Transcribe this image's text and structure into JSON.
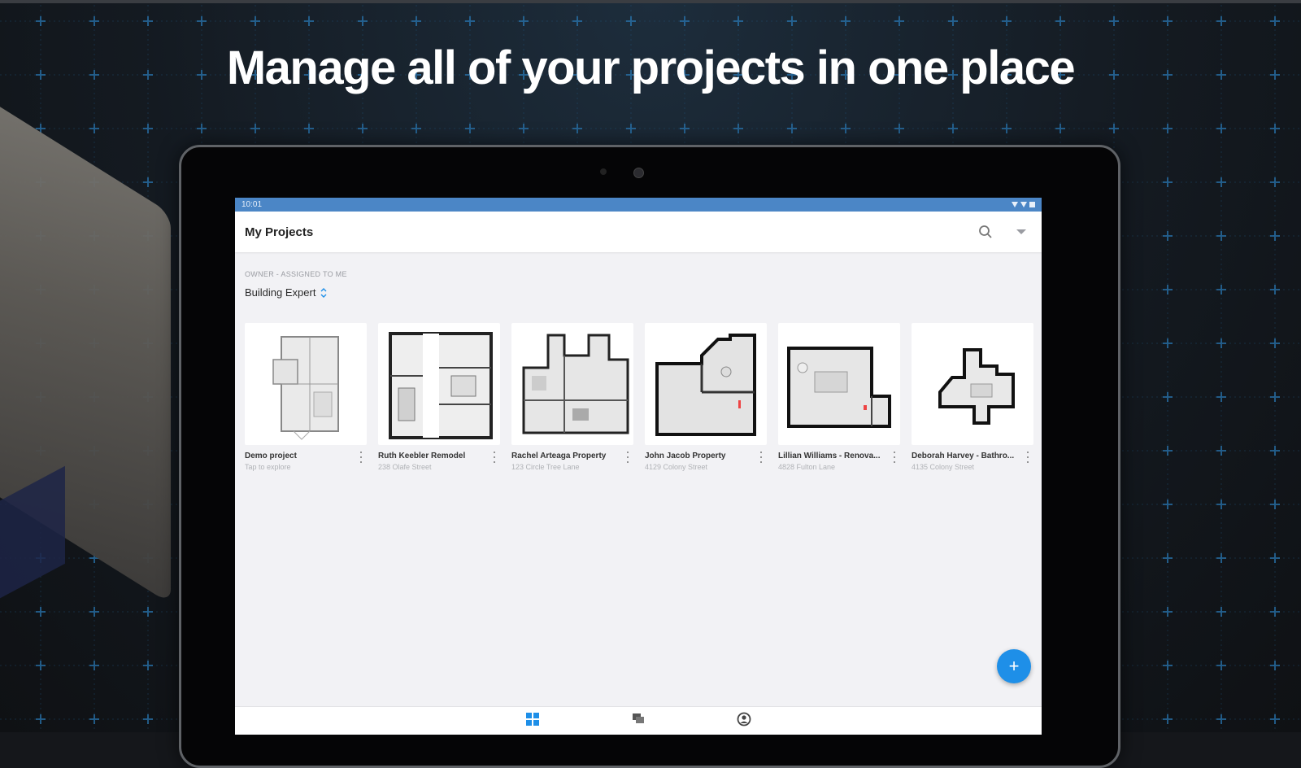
{
  "headline": "Manage all of your projects in one place",
  "colors": {
    "status_bar": "#4b86c6",
    "fab": "#1e8fe8",
    "nav_active": "#1e8fe8",
    "grid_lines": "#1f5d8a"
  },
  "status_bar": {
    "time": "10:01",
    "icons": [
      "wifi-icon",
      "signal-icon",
      "battery-icon"
    ]
  },
  "app_bar": {
    "title": "My Projects",
    "actions": [
      "search-icon",
      "filter-icon"
    ]
  },
  "filter": {
    "label": "OWNER - ASSIGNED TO ME",
    "workspace": "Building Expert"
  },
  "projects": [
    {
      "title": "Demo project",
      "subtitle": "Tap to explore"
    },
    {
      "title": "Ruth Keebler Remodel",
      "subtitle": "238 Olafe Street"
    },
    {
      "title": "Rachel Arteaga Property",
      "subtitle": "123 Circle Tree Lane"
    },
    {
      "title": "John Jacob Property",
      "subtitle": "4129 Colony Street"
    },
    {
      "title": "Lillian Williams - Renova...",
      "subtitle": "4828 Fulton Lane"
    },
    {
      "title": "Deborah Harvey - Bathro...",
      "subtitle": "4135 Colony Street"
    }
  ],
  "fab": {
    "label": "+"
  },
  "bottom_nav": [
    {
      "icon": "grid-icon"
    },
    {
      "icon": "chat-icon"
    },
    {
      "icon": "profile-icon"
    }
  ]
}
